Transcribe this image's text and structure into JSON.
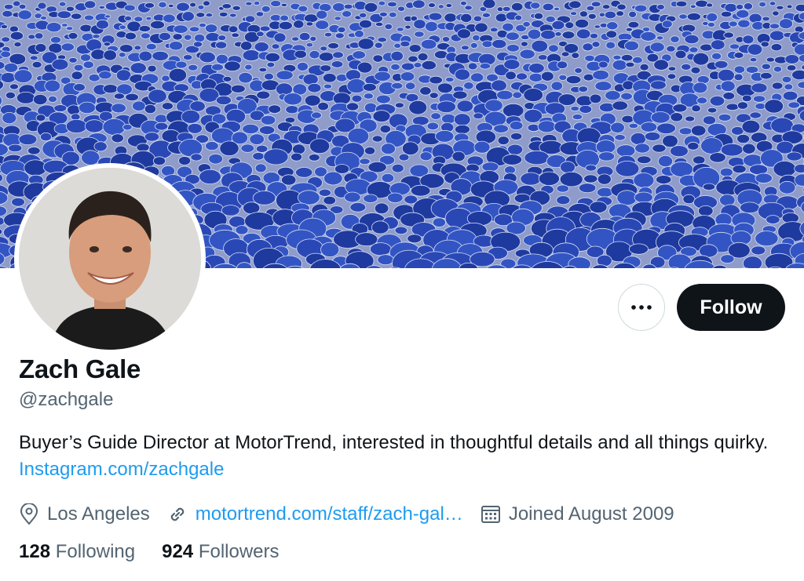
{
  "profile": {
    "name": "Zach Gale",
    "handle": "@zachgale",
    "bio_text": "Buyer’s Guide Director at MotorTrend, interested in thoughtful details and all things quirky.",
    "bio_link": "Instagram.com/zachgale",
    "location": "Los Angeles",
    "website": "motortrend.com/staff/zach-gal…",
    "joined": "Joined August 2009",
    "following_count": "128",
    "following_label": "Following",
    "followers_count": "924",
    "followers_label": "Followers"
  },
  "actions": {
    "follow_label": "Follow",
    "more_icon": "more-dots-icon"
  },
  "colors": {
    "accent": "#1d9bf0",
    "text": "#0f1419",
    "muted": "#536471",
    "button_dark": "#0f1419",
    "banner_blue": "#2a48b5"
  },
  "icons": {
    "location": "location-pin-icon",
    "link": "link-icon",
    "calendar": "calendar-icon"
  }
}
